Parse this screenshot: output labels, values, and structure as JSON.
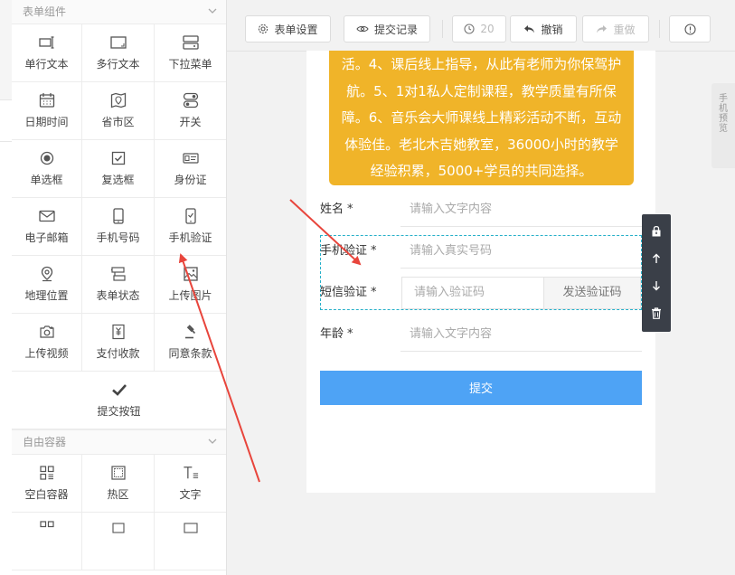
{
  "panel": {
    "group1": {
      "title": "表单组件",
      "items": [
        {
          "label": "单行文本",
          "icon": "single-line-text-icon"
        },
        {
          "label": "多行文本",
          "icon": "multi-line-text-icon"
        },
        {
          "label": "下拉菜单",
          "icon": "dropdown-menu-icon"
        },
        {
          "label": "日期时间",
          "icon": "calendar-icon"
        },
        {
          "label": "省市区",
          "icon": "map-region-icon"
        },
        {
          "label": "开关",
          "icon": "toggle-icon"
        },
        {
          "label": "单选框",
          "icon": "radio-icon"
        },
        {
          "label": "复选框",
          "icon": "checkbox-icon"
        },
        {
          "label": "身份证",
          "icon": "id-card-icon"
        },
        {
          "label": "电子邮箱",
          "icon": "mail-icon"
        },
        {
          "label": "手机号码",
          "icon": "mobile-icon"
        },
        {
          "label": "手机验证",
          "icon": "mobile-verify-icon"
        },
        {
          "label": "地理位置",
          "icon": "location-icon"
        },
        {
          "label": "表单状态",
          "icon": "form-status-icon"
        },
        {
          "label": "上传图片",
          "icon": "image-upload-icon"
        },
        {
          "label": "上传视频",
          "icon": "camera-icon"
        },
        {
          "label": "支付收款",
          "icon": "payment-icon"
        },
        {
          "label": "同意条款",
          "icon": "gavel-icon"
        },
        {
          "label": "提交按钮",
          "icon": "check-icon"
        }
      ]
    },
    "group2": {
      "title": "自由容器",
      "items": [
        {
          "label": "空白容器",
          "icon": "grid-icon"
        },
        {
          "label": "热区",
          "icon": "hotspot-icon"
        },
        {
          "label": "文字",
          "icon": "text-icon"
        }
      ]
    }
  },
  "toolbar": {
    "form_settings": "表单设置",
    "submit_records": "提交记录",
    "history_count": "20",
    "undo": "撤销",
    "redo": "重做"
  },
  "edge_tab": {
    "text": "手机预览"
  },
  "form": {
    "banner_text": "活。4、课后线上指导，从此有老师为你保驾护航。5、1对1私人定制课程，教学质量有所保障。6、音乐会大师课线上精彩活动不断，互动体验佳。老北木吉她教室，36000小时的教学经验积累，5000+学员的共同选择。",
    "fields": [
      {
        "label": "姓名",
        "required": "*",
        "placeholder": "请输入文字内容"
      },
      {
        "label": "手机验证",
        "required": "*",
        "placeholder": "请输入真实号码"
      },
      {
        "label": "短信验证",
        "required": "*",
        "placeholder": "请输入验证码",
        "button": "发送验证码"
      },
      {
        "label": "年龄",
        "required": "*",
        "placeholder": "请输入文字内容"
      }
    ],
    "submit_label": "提交"
  },
  "colors": {
    "banner": "#f0b429",
    "submit": "#4ea3f5",
    "selection": "#27b0c9",
    "annotation": "#e8453c"
  }
}
